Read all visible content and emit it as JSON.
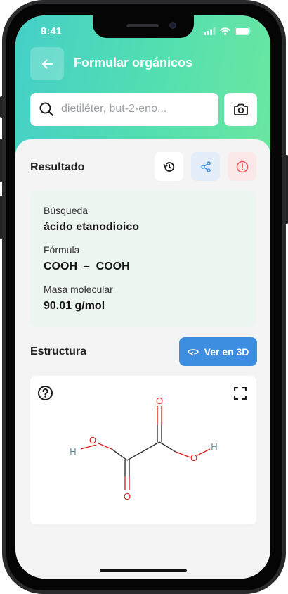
{
  "status_bar": {
    "time": "9:41"
  },
  "header": {
    "title": "Formular orgánicos",
    "search": {
      "value": "",
      "placeholder": "dietiléter, but-2-eno..."
    }
  },
  "result": {
    "label": "Resultado",
    "fields": [
      {
        "label": "Búsqueda",
        "value": "ácido etanodioico"
      },
      {
        "label": "Fórmula",
        "value": "COOH  –  COOH"
      },
      {
        "label": "Masa molecular",
        "value": "90.01 g/mol"
      }
    ]
  },
  "structure": {
    "label": "Estructura",
    "view_3d_label": "Ver en 3D",
    "atoms": {
      "oxygen": "O",
      "hydrogen": "H"
    }
  },
  "icons": {
    "back": "arrow-left-icon",
    "search": "search-icon",
    "camera": "camera-icon",
    "history": "history-icon",
    "share": "share-icon",
    "report": "alert-icon",
    "view3d": "rotate-3d-icon",
    "help": "help-icon",
    "fullscreen": "fullscreen-icon"
  },
  "colors": {
    "header_gradient_start": "#44cfc8",
    "header_gradient_end": "#6be79f",
    "accent_blue": "#3d8ee0",
    "oxygen": "#e02020",
    "hydrogen": "#5c8f8f"
  }
}
